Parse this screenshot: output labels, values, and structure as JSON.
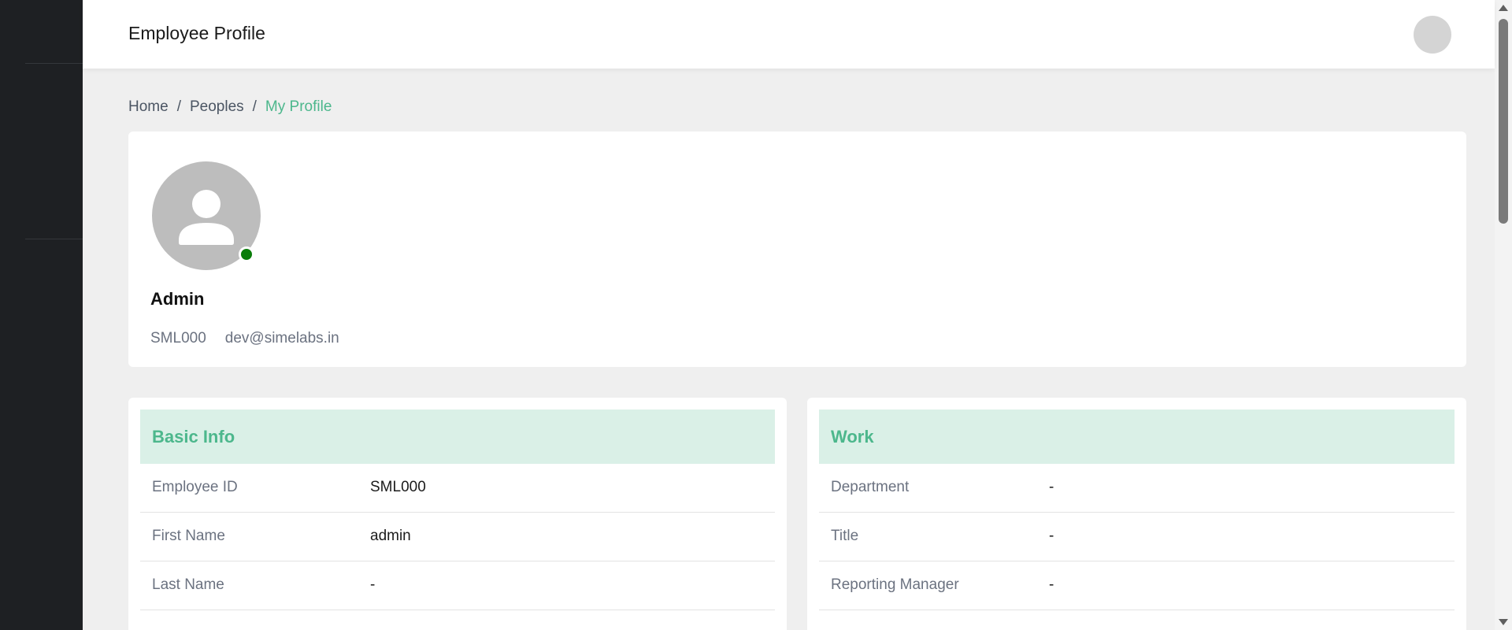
{
  "header": {
    "title": "Employee Profile"
  },
  "breadcrumb": {
    "items": [
      "Home",
      "Peoples",
      "My Profile"
    ],
    "separator": "/"
  },
  "profile": {
    "name": "Admin",
    "employee_id": "SML000",
    "email": "dev@simelabs.in",
    "status": "online",
    "status_color": "#0a7d0a"
  },
  "basic_info": {
    "title": "Basic Info",
    "rows": [
      {
        "label": "Employee ID",
        "value": "SML000"
      },
      {
        "label": "First Name",
        "value": "admin"
      },
      {
        "label": "Last Name",
        "value": "-"
      }
    ]
  },
  "work": {
    "title": "Work",
    "rows": [
      {
        "label": "Department",
        "value": "-"
      },
      {
        "label": "Title",
        "value": "-"
      },
      {
        "label": "Reporting Manager",
        "value": "-"
      }
    ]
  },
  "colors": {
    "accent": "#4cb78c",
    "accent_bg": "#daf0e7",
    "sidebar": "#1e2023",
    "page_bg": "#efefef"
  }
}
